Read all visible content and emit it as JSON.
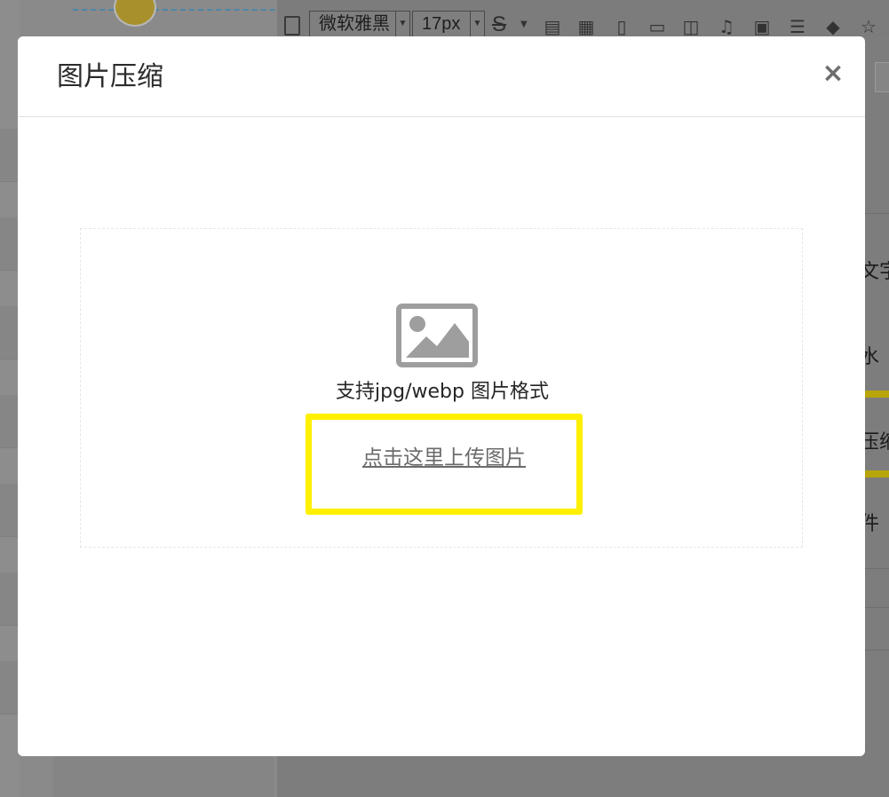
{
  "toolbar": {
    "font_family_value": "微软雅黑",
    "font_size_value": "17px",
    "icons": [
      "document-icon",
      "strikethrough-icon",
      "table-icon",
      "grid-icon",
      "file-icon",
      "image-icon",
      "gallery-icon",
      "music-icon",
      "video-icon",
      "divider-icon",
      "eraser-icon",
      "special-icon"
    ]
  },
  "side_panel": {
    "items": [
      "文字",
      "水",
      "压缩",
      "件"
    ]
  },
  "modal": {
    "title": "图片压缩",
    "close_label": "×",
    "dropzone": {
      "icon": "image-placeholder-icon",
      "support_text": "支持jpg/webp 图片格式",
      "upload_link": "点击这里上传图片"
    }
  },
  "colors": {
    "highlight": "#ffef00",
    "overlay": "#7d7d7d",
    "icon_gray": "#9e9e9e"
  }
}
